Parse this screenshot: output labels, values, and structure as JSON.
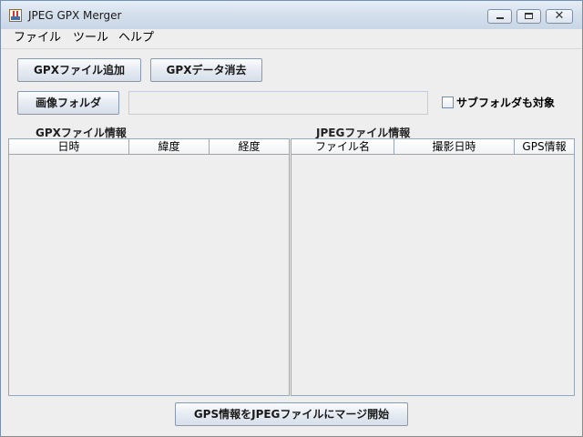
{
  "window": {
    "title": "JPEG GPX Merger",
    "controls": {
      "minimize_icon": "minimize-icon",
      "maximize_icon": "maximize-icon",
      "close_glyph": "✕"
    }
  },
  "menu": {
    "items": [
      {
        "label": "ファイル"
      },
      {
        "label": "ツール"
      },
      {
        "label": "ヘルプ"
      }
    ]
  },
  "toolbar": {
    "add_gpx_label": "GPXファイル追加",
    "clear_gpx_label": "GPXデータ消去",
    "image_folder_label": "画像フォルダ",
    "folder_path_value": "",
    "subfolder_label": "サブフォルダも対象",
    "subfolder_checked": false
  },
  "gpx_panel": {
    "label": "GPXファイル情報",
    "columns": [
      "日時",
      "緯度",
      "経度"
    ],
    "rows": []
  },
  "jpeg_panel": {
    "label": "JPEGファイル情報",
    "columns": [
      "ファイル名",
      "撮影日時",
      "GPS情報"
    ],
    "rows": []
  },
  "footer": {
    "merge_label": "GPS情報をJPEGファイルにマージ開始"
  },
  "colors": {
    "window_bg": "#eeeeee",
    "titlebar": "#d4dfec",
    "border": "#9aa6b4"
  }
}
